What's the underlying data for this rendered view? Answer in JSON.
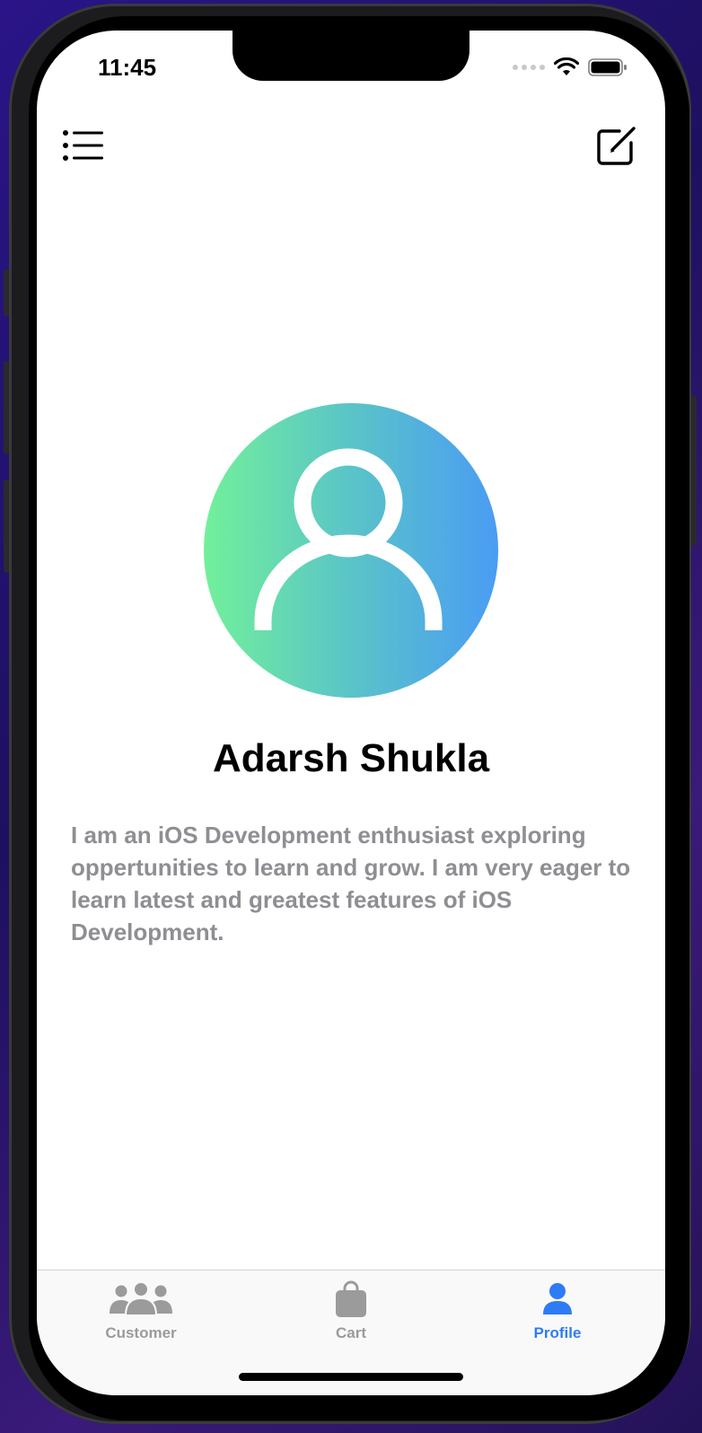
{
  "status_bar": {
    "time": "11:45"
  },
  "profile": {
    "name": "Adarsh Shukla",
    "bio": "I am an iOS Development enthusiast exploring oppertunities to learn and grow. I am very eager to learn latest and greatest features of iOS Development."
  },
  "tabs": [
    {
      "label": "Customer",
      "icon": "person-3-icon",
      "selected": false
    },
    {
      "label": "Cart",
      "icon": "bag-icon",
      "selected": false
    },
    {
      "label": "Profile",
      "icon": "person-icon",
      "selected": true
    }
  ],
  "colors": {
    "accent": "#2f7bf5",
    "inactive": "#8e8e93",
    "avatar_gradient_start": "#72f09a",
    "avatar_gradient_end": "#4a9cf4"
  }
}
